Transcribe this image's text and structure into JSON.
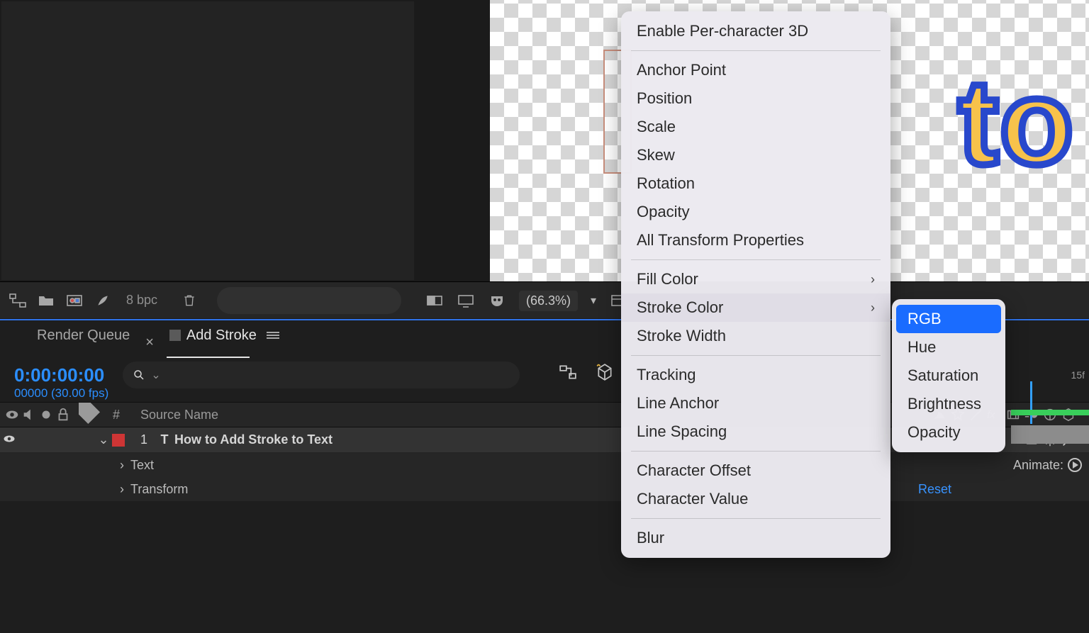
{
  "preview": {
    "text_to": "to"
  },
  "toolbar": {
    "bpc_label": "8 bpc",
    "zoom_pct": "(66.3%)"
  },
  "tabs": {
    "render_queue": "Render Queue",
    "add_stroke": "Add Stroke"
  },
  "timeline": {
    "timecode": "0:00:00:00",
    "frames": "00000 (30.00 fps)",
    "columns": {
      "hash": "#",
      "source_name": "Source Name"
    },
    "layer": {
      "index": "1",
      "type_glyph": "T",
      "name": "How to Add Stroke to Text"
    },
    "text_prop": "Text",
    "animate_label": "Animate:",
    "transform_prop": "Transform",
    "reset_label": "Reset",
    "ruler_label": "15f"
  },
  "ctx": {
    "enable_3d": "Enable Per-character 3D",
    "anchor_point": "Anchor Point",
    "position": "Position",
    "scale": "Scale",
    "skew": "Skew",
    "rotation": "Rotation",
    "opacity": "Opacity",
    "all_transform": "All Transform Properties",
    "fill_color": "Fill Color",
    "stroke_color": "Stroke Color",
    "stroke_width": "Stroke Width",
    "tracking": "Tracking",
    "line_anchor": "Line Anchor",
    "line_spacing": "Line Spacing",
    "char_offset": "Character Offset",
    "char_value": "Character Value",
    "blur": "Blur"
  },
  "ctx_sub": {
    "rgb": "RGB",
    "hue": "Hue",
    "saturation": "Saturation",
    "brightness": "Brightness",
    "opacity": "Opacity"
  }
}
